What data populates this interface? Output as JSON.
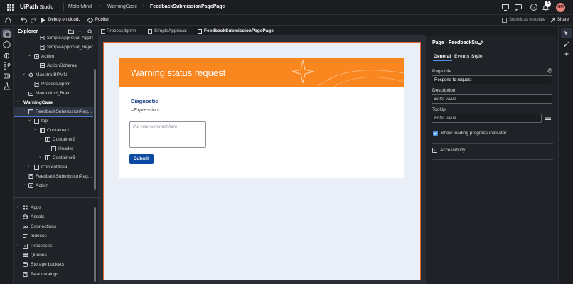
{
  "app": {
    "name": "UiPath",
    "product": "Studio"
  },
  "breadcrumb": [
    "MotorMind",
    "WarningCase",
    "FeedbackSubmissionPagePage"
  ],
  "topbar": {
    "notification_count": "6",
    "avatar_initials": "HM"
  },
  "toolbar": {
    "debug_label": "Debug on cloud",
    "publish_label": "Publish",
    "submit_template_label": "Submit as template",
    "share_label": "Share"
  },
  "explorer": {
    "title": "Explorer",
    "tree": [
      {
        "label": "SimpleApproval_Approval...",
        "depth": 3,
        "chevron": "",
        "icon": "doc-icon"
      },
      {
        "label": "SimpleApproval_RejectB...",
        "depth": 3,
        "chevron": "",
        "icon": "doc-icon"
      },
      {
        "label": "Action",
        "depth": 2,
        "chevron": "down",
        "icon": "action-icon"
      },
      {
        "label": "ActionSchema",
        "depth": 3,
        "chevron": "",
        "icon": "schema-icon"
      },
      {
        "label": "Maestro BPMN",
        "depth": 1,
        "chevron": "down",
        "icon": "bpmn-icon"
      },
      {
        "label": "Process.bpmn",
        "depth": 2,
        "chevron": "",
        "icon": "doc-icon"
      },
      {
        "label": "MotorMind_Brain",
        "depth": 1,
        "chevron": "",
        "icon": "agent-icon"
      },
      {
        "label": "WarningCase",
        "depth": 0,
        "chevron": "down",
        "icon": "",
        "bold": true
      },
      {
        "label": "FeedbackSubmissionPag...",
        "depth": 1,
        "chevron": "down",
        "icon": "page-icon",
        "selected": true
      },
      {
        "label": "top",
        "depth": 2,
        "chevron": "down",
        "icon": "container-icon"
      },
      {
        "label": "Container1",
        "depth": 3,
        "chevron": "down",
        "icon": "container-icon"
      },
      {
        "label": "Container2",
        "depth": 4,
        "chevron": "down",
        "icon": "container-icon"
      },
      {
        "label": "Header",
        "depth": 5,
        "chevron": "",
        "icon": "header-icon"
      },
      {
        "label": "Container3",
        "depth": 4,
        "chevron": "right",
        "icon": "container-icon"
      },
      {
        "label": "ContentArea",
        "depth": 2,
        "chevron": "right",
        "icon": "container-icon"
      },
      {
        "label": "FeedbackSubmissionPag...",
        "depth": 1,
        "chevron": "",
        "icon": "doc-icon"
      },
      {
        "label": "Action",
        "depth": 1,
        "chevron": "down",
        "icon": "action-icon"
      }
    ],
    "resources": [
      {
        "label": "Apps",
        "chevron": "right",
        "icon": "apps-icon"
      },
      {
        "label": "Assets",
        "chevron": "",
        "icon": "assets-icon"
      },
      {
        "label": "Connections",
        "chevron": "",
        "icon": "connections-icon"
      },
      {
        "label": "Indexes",
        "chevron": "",
        "icon": "indexes-icon"
      },
      {
        "label": "Processes",
        "chevron": "right",
        "icon": "processes-icon"
      },
      {
        "label": "Queues",
        "chevron": "",
        "icon": "queues-icon"
      },
      {
        "label": "Storage buckets",
        "chevron": "",
        "icon": "storage-icon"
      },
      {
        "label": "Task catalogs",
        "chevron": "",
        "icon": "catalog-icon"
      }
    ]
  },
  "editor_tabs": [
    {
      "label": "Process.bpmn",
      "active": false
    },
    {
      "label": "SimpleApproval",
      "active": false
    },
    {
      "label": "FeedbackSubmissionPagePage",
      "active": true
    }
  ],
  "page_preview": {
    "header_title": "Warning status request",
    "diagnostic_label": "Diagnostic",
    "expression_text": "=Expression",
    "comment_placeholder": "Put your comment here",
    "submit_label": "Submit"
  },
  "properties": {
    "title": "Page - FeedbackSu...",
    "tabs": [
      "General",
      "Events",
      "Style"
    ],
    "active_tab": "General",
    "page_title_label": "Page title",
    "page_title_value": "Respond to request",
    "description_label": "Description",
    "description_placeholder": "Enter value",
    "tooltip_label": "Tooltip",
    "tooltip_placeholder": "Enter value",
    "loading_checkbox_label": "Show loading progress indicator",
    "loading_checked": true,
    "accessibility_label": "Accessibility"
  },
  "colors": {
    "accent": "#fa861f",
    "submit_button": "#0b4aa2",
    "diagnostic_text": "#1c3f8a",
    "selection_outline": "#e0663a",
    "checkbox": "#4a90e2",
    "active_tab_underline": "#4a90e2"
  }
}
